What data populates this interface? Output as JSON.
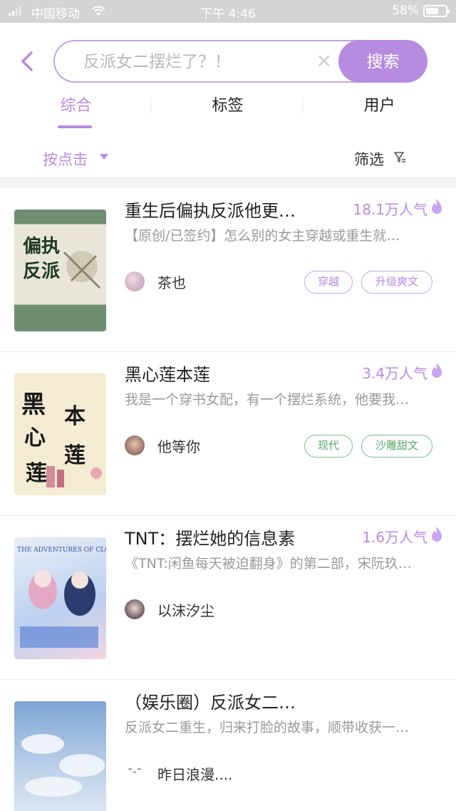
{
  "status_bar": {
    "carrier": "中国移动",
    "time": "下午 4:46",
    "battery": "58%"
  },
  "search": {
    "placeholder": "反派女二摆烂了？！",
    "button": "搜索"
  },
  "tabs": [
    {
      "label": "综合",
      "active": true
    },
    {
      "label": "标签",
      "active": false
    },
    {
      "label": "用户",
      "active": false
    }
  ],
  "filters": {
    "sort_label": "按点击",
    "filter_label": "筛选"
  },
  "books": [
    {
      "title": "重生后偏执反派他更…",
      "popularity": "18.1万人气",
      "description": "【原创/已签约】怎么别的女主穿越或重生就…",
      "author": "茶也",
      "tags": [
        {
          "label": "穿越",
          "color": "purple"
        },
        {
          "label": "升级爽文",
          "color": "purple"
        }
      ],
      "cover_text": "偏执反派",
      "cover_color": "#6f8e70"
    },
    {
      "title": "黑心莲本莲",
      "popularity": "3.4万人气",
      "description": "我是一个穿书女配，有一个摆烂系统，他要我…",
      "author": "他等你",
      "tags": [
        {
          "label": "现代",
          "color": "green"
        },
        {
          "label": "沙雕甜文",
          "color": "green"
        }
      ],
      "cover_text": "黑心莲本莲",
      "cover_color": "#f3ecd2"
    },
    {
      "title": "TNT：摆烂她的信息素",
      "popularity": "1.6万人气",
      "description": "《TNT:闲鱼每天被迫翻身》的第二部，宋阮玖…",
      "author": "以沫汐尘",
      "tags": [],
      "cover_text": "THE ADVENTURES OF CLOUDS",
      "cover_color": "#c9d8f0"
    },
    {
      "title": "（娱乐圈）反派女二…",
      "popularity": "",
      "description": "反派女二重生，归来打脸的故事，顺带收获一…",
      "author": "昨日浪漫....",
      "tags": [],
      "cover_text": "",
      "cover_color": "#8fb0d6"
    }
  ],
  "colors": {
    "accent": "#b78be0",
    "accent_border": "#c4a4e6",
    "tag_green": "#5aa56a"
  }
}
